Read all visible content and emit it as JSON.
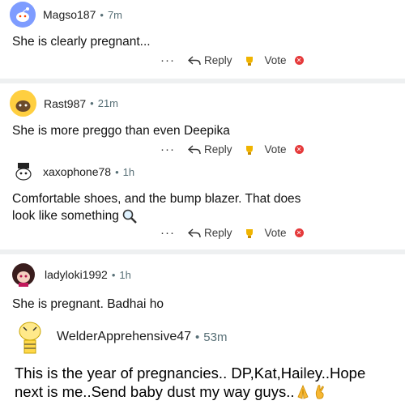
{
  "comments": [
    {
      "user": "Magso187",
      "age": "7m",
      "text": "She is clearly pregnant...",
      "reply": "Reply",
      "vote": "Vote",
      "more": "···"
    },
    {
      "user": "Rast987",
      "age": "21m",
      "text": "She is more preggo than even Deepika",
      "reply": "Reply",
      "vote": "Vote",
      "more": "···"
    },
    {
      "user": "xaxophone78",
      "age": "1h",
      "text_line1": "Comfortable shoes, and the bump blazer. That does",
      "text_line2": "look like something",
      "reply": "Reply",
      "vote": "Vote",
      "more": "···"
    },
    {
      "user": "ladyloki1992",
      "age": "1h",
      "text": "She is pregnant. Badhai ho"
    },
    {
      "user": "WelderApprehensive47",
      "age": "53m",
      "text_line1": "This is the year of pregnancies.. DP,Kat,Hailey..Hope",
      "text_line2": "next is me..Send baby dust my way guys.."
    }
  ],
  "separator_dot": "•",
  "colors": {
    "accent_vote": "#e5393a",
    "separator": "#eef0f1"
  }
}
